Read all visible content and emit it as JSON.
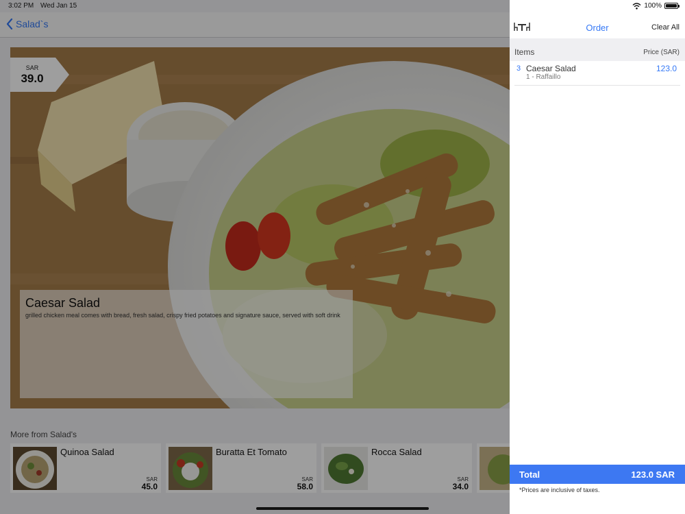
{
  "status_bar": {
    "time": "3:02 PM",
    "date": "Wed Jan 15",
    "battery": "100%",
    "battery_level": 1.0
  },
  "nav": {
    "back_label": "Salad`s"
  },
  "item": {
    "currency": "SAR",
    "price": "39.0",
    "name": "Caesar Salad",
    "description": "grilled chicken meal comes with bread, fresh salad, crispy fried potatoes and signature sauce, served with soft drink"
  },
  "more": {
    "title": "More from Salad's",
    "products": [
      {
        "name": "Quinoa Salad",
        "currency": "SAR",
        "price": "45.0"
      },
      {
        "name": "Buratta Et Tomato",
        "currency": "SAR",
        "price": "58.0"
      },
      {
        "name": "Rocca Salad",
        "currency": "SAR",
        "price": "34.0"
      }
    ]
  },
  "order": {
    "title": "Order",
    "clear_all": "Clear All",
    "items_label": "Items",
    "price_label": "Price (SAR)",
    "rows": [
      {
        "qty": "3",
        "name": "Caesar Salad",
        "sub": "1 - Raffaillo",
        "price": "123.0"
      }
    ],
    "total_label": "Total",
    "total_value": "123.0 SAR",
    "tax_note": "*Prices are inclusive of taxes."
  },
  "colors": {
    "accent": "#3478f6",
    "total_bar": "#3d78f2",
    "background": "#efeff2"
  }
}
